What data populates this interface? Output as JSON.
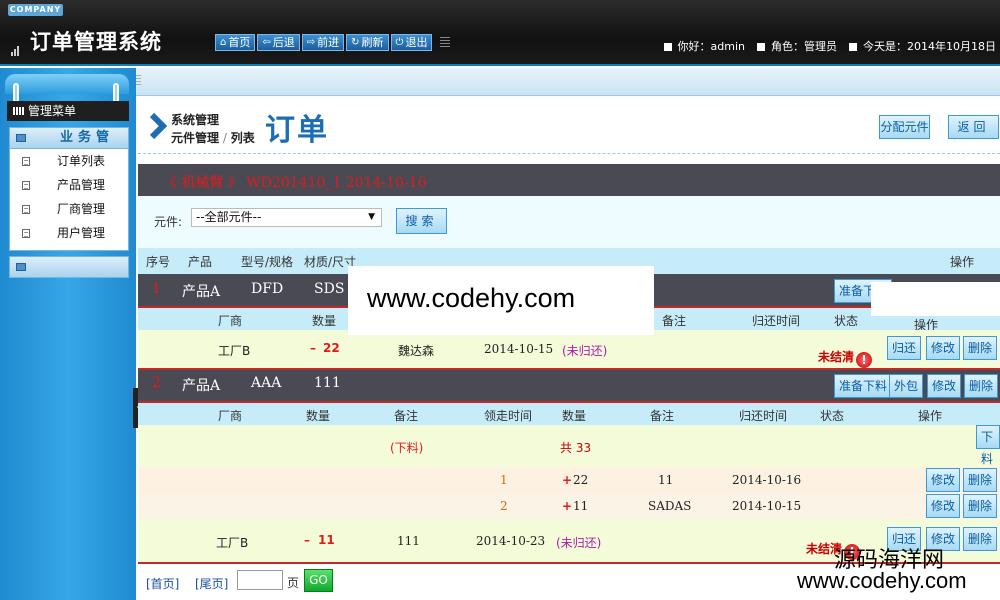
{
  "header": {
    "company": "COMPANY",
    "title": "订单管理系统",
    "nav": [
      {
        "icon": "home-icon",
        "glyph": "⌂",
        "label": "首页"
      },
      {
        "icon": "back-arrow-icon",
        "glyph": "⇦",
        "label": "后退"
      },
      {
        "icon": "forward-arrow-icon",
        "glyph": "⇨",
        "label": "前进"
      },
      {
        "icon": "refresh-icon",
        "glyph": "↻",
        "label": "刷新"
      },
      {
        "icon": "power-icon",
        "glyph": "⏻",
        "label": "退出"
      }
    ],
    "user": "你好：admin",
    "role": "角色：管理员",
    "today": "今天是：2014年10月18日"
  },
  "sidebar": {
    "menu_title": "管理菜单",
    "group_title": "业务管理",
    "items": [
      "订单列表",
      "产品管理",
      "厂商管理",
      "用户管理"
    ]
  },
  "main": {
    "crumb_top": "系统管理",
    "crumb_part1": "元件管理",
    "crumb_sep": " / ",
    "crumb_part2": "列表",
    "title": "订单",
    "assign_btn": "分配元件",
    "back_btn": "返回",
    "order_info": "《 机械臂 》 WD201410_1  2014-10-16",
    "filter": {
      "label": "元件:",
      "selected": "--全部元件--",
      "search_btn": "搜索"
    },
    "columns": {
      "no": "序号",
      "product": "产品",
      "model": "型号/规格",
      "material": "材质/尺寸",
      "ops": "操作"
    },
    "sub_columns": {
      "vendor": "厂商",
      "qty": "数量",
      "remark": "备注",
      "take_time": "领走时间",
      "return_time": "归还时间",
      "status": "状态",
      "ops": "操作"
    },
    "rows": [
      {
        "no": "1",
        "product": "产品A",
        "model": "DFD",
        "material": "SDS",
        "prepare_btn": "准备下料",
        "detail": {
          "vendor": "工厂B",
          "qty_sign": "–",
          "qty": "22",
          "person": "魏达森",
          "date": "2014-10-15",
          "status": "(未归还)",
          "settle": "未结清",
          "return_btn": "归还",
          "edit_btn": "修改",
          "delete_btn": "删除"
        }
      },
      {
        "no": "2",
        "product": "产品A",
        "model": "AAA",
        "material": "111",
        "prepare_btn": "准备下料",
        "outsource_btn": "外包",
        "edit_btn": "修改",
        "delete_btn": "删除",
        "cut_label": "(下料)",
        "total": "共 33",
        "cut_btn": "下料",
        "subrows": [
          {
            "idx": "1",
            "sign": "+",
            "qty": "22",
            "remark": "11",
            "date": "2014-10-16",
            "edit_btn": "修改",
            "delete_btn": "删除"
          },
          {
            "idx": "2",
            "sign": "+",
            "qty": "11",
            "remark": "SADAS",
            "date": "2014-10-15",
            "edit_btn": "修改",
            "delete_btn": "删除"
          }
        ],
        "detail": {
          "vendor": "工厂B",
          "qty_sign": "–",
          "qty": "11",
          "remark": "111",
          "date": "2014-10-23",
          "status": "(未归还)",
          "settle": "未结清",
          "return_btn": "归还",
          "edit_btn": "修改",
          "delete_btn": "删除"
        }
      }
    ],
    "pager": {
      "first": "[首页]",
      "last": "[尾页]",
      "page_label": "页",
      "go": "GO"
    }
  },
  "watermark": {
    "center": "www.codehy.com",
    "corner_cn": "源码海洋网",
    "corner_url": "www.codehy.com"
  }
}
